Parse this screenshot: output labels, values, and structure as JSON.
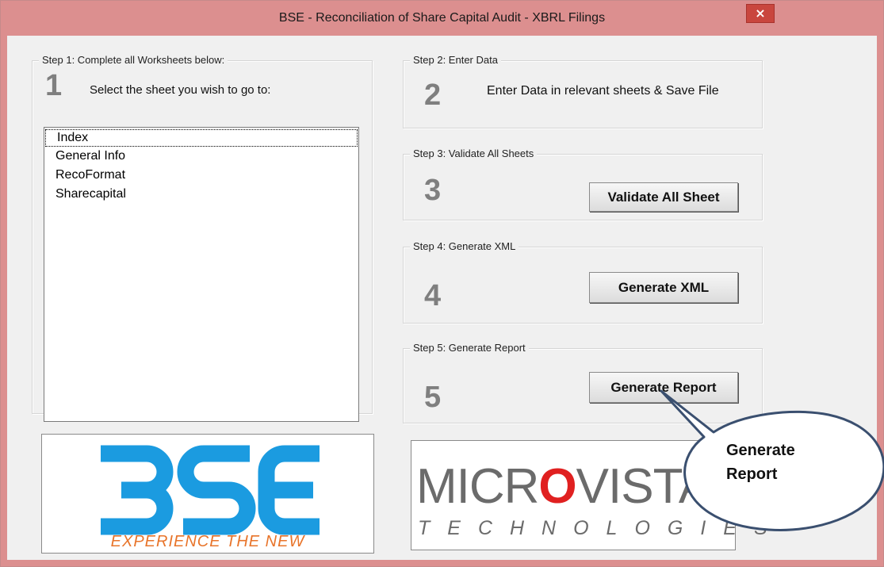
{
  "window": {
    "title": "BSE - Reconciliation of Share Capital Audit - XBRL Filings",
    "close_glyph": "×"
  },
  "step1": {
    "legend": "Step 1: Complete all Worksheets below:",
    "number": "1",
    "instruction": "Select the sheet you wish to go to:",
    "sheets": [
      "Index",
      "General Info",
      "RecoFormat",
      "Sharecapital"
    ],
    "selected_index": 0
  },
  "step2": {
    "legend": "Step 2: Enter Data",
    "number": "2",
    "instruction": "Enter Data in relevant sheets & Save File"
  },
  "step3": {
    "legend": "Step 3: Validate All Sheets",
    "number": "3",
    "button": "Validate All Sheet"
  },
  "step4": {
    "legend": "Step 4: Generate XML",
    "number": "4",
    "button": "Generate XML"
  },
  "step5": {
    "legend": "Step 5: Generate Report",
    "number": "5",
    "button": "Generate Report"
  },
  "logos": {
    "bse": {
      "wordmark": "BSE",
      "tagline": "EXPERIENCE THE NEW",
      "brand_blue": "#1b9be0",
      "tagline_orange": "#e8742a"
    },
    "microvista": {
      "wordmark_left": "MICR",
      "wordmark_o": "O",
      "wordmark_right": "VISTA",
      "tagline": "TECHNOLOGIES",
      "o_red": "#e02020"
    }
  },
  "callout": {
    "text": "Generate Report"
  },
  "colors": {
    "titlebar": "#dc8f8f",
    "close": "#c9463e",
    "dialog": "#f0f0f0"
  }
}
